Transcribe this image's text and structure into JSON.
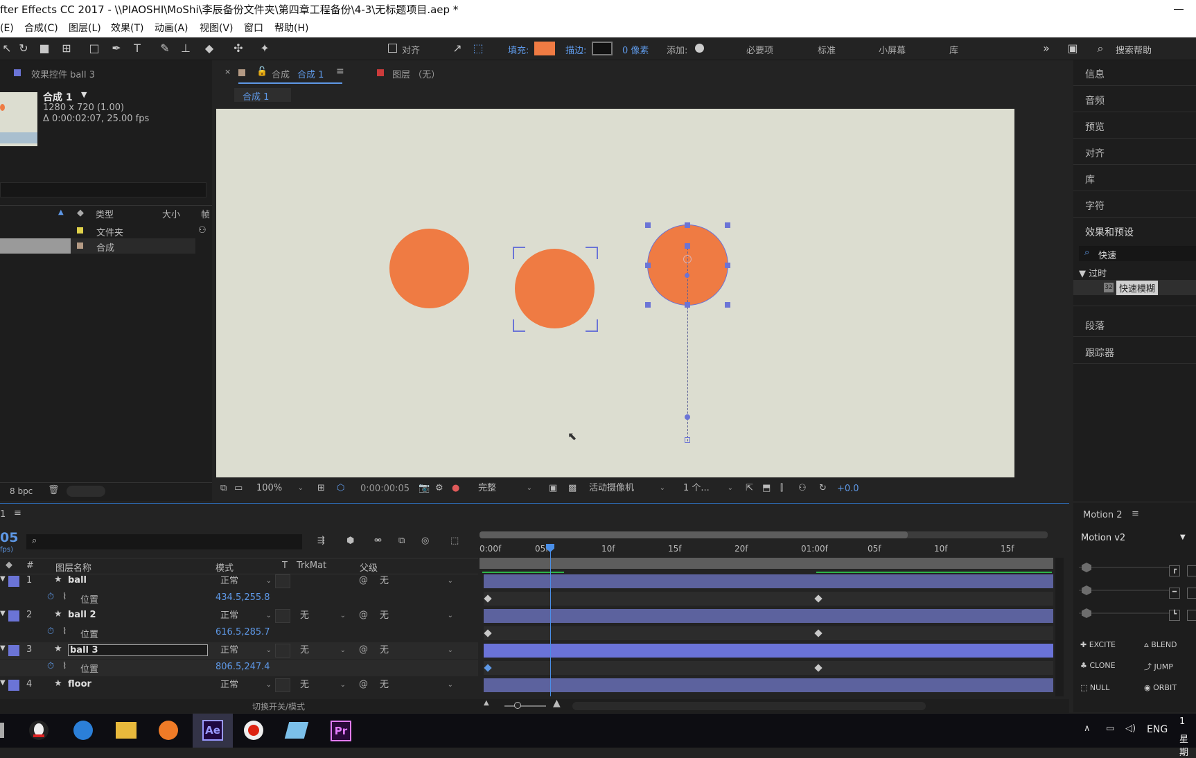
{
  "window": {
    "title": "fter Effects CC 2017 - \\\\PIAOSHI\\MoShi\\李辰备份文件夹\\第四章工程备份\\4-3\\无标题项目.aep *"
  },
  "menu": [
    "(E)",
    "合成(C)",
    "图层(L)",
    "效果(T)",
    "动画(A)",
    "视图(V)",
    "窗口",
    "帮助(H)"
  ],
  "toolbar": {
    "align_label": "对齐",
    "fill_label": "填充:",
    "fill_color": "#f07b43",
    "stroke_label": "描边:",
    "stroke_value": "0 像素",
    "add_label": "添加:",
    "workspaces": [
      "必要项",
      "标准",
      "小屏幕",
      "库"
    ],
    "search_help": "搜索帮助"
  },
  "project_panel": {
    "tab": "效果控件 ball 3",
    "comp_name": "合成 1",
    "comp_size": "1280 x 720 (1.00)",
    "comp_duration": "Δ 0:00:02:07, 25.00 fps",
    "col_type": "类型",
    "col_size": "大小",
    "col_extra": "帧",
    "items": [
      {
        "type": "文件夹",
        "color": "#e0d24a"
      },
      {
        "type": "合成",
        "color": "#b49a84"
      }
    ],
    "bpc": "8 bpc"
  },
  "comp_panel": {
    "tab_label": "合成",
    "tab_active": "合成 1",
    "layer_tab": "图层 （无）",
    "breadcrumb": "合成 1",
    "zoom": "100%",
    "timecode": "0:00:00:05",
    "resolution": "完整",
    "camera": "活动摄像机",
    "views": "1 个...",
    "exposure": "+0.0",
    "bg_color": "#dcddd0",
    "ball_color": "#ef7b43"
  },
  "right_panel": {
    "items": [
      "信息",
      "音频",
      "预览",
      "对齐",
      "库",
      "字符",
      "效果和预设"
    ],
    "search_value": "快速",
    "group": "▼ 过时",
    "effect": "快速模糊",
    "effect_badge": "32",
    "items2": [
      "段落",
      "跟踪器"
    ]
  },
  "timeline": {
    "tab": "1",
    "time": "05",
    "fps": "fps)",
    "headers": {
      "name": "图层名称",
      "mode": "模式",
      "t": "T",
      "trkmat": "TrkMat",
      "parent": "父级",
      "num": "#"
    },
    "layers": [
      {
        "num": "1",
        "name": "ball",
        "mode": "正常",
        "trkmat": "",
        "parent": "无",
        "prop": "位置",
        "value": "434.5,255.8"
      },
      {
        "num": "2",
        "name": "ball 2",
        "mode": "正常",
        "trkmat": "无",
        "parent": "无",
        "prop": "位置",
        "value": "616.5,285.7"
      },
      {
        "num": "3",
        "name": "ball 3",
        "mode": "正常",
        "trkmat": "无",
        "parent": "无",
        "prop": "位置",
        "value": "806.5,247.4"
      },
      {
        "num": "4",
        "name": "floor",
        "mode": "正常",
        "trkmat": "无",
        "parent": "无",
        "prop": "",
        "value": ""
      }
    ],
    "ruler": [
      "0:00f",
      "05f",
      "10f",
      "15f",
      "20f",
      "01:00f",
      "05f",
      "10f",
      "15f"
    ],
    "toggle_label": "切换开关/模式"
  },
  "motion_panel": {
    "tab": "Motion 2",
    "version": "Motion v2",
    "buttons": [
      "EXCITE",
      "BLEND",
      "CLONE",
      "JUMP",
      "NULL",
      "ORBIT"
    ]
  },
  "taskbar": {
    "lang": "ENG",
    "clock_top": "1",
    "clock_bottom": "星期"
  }
}
